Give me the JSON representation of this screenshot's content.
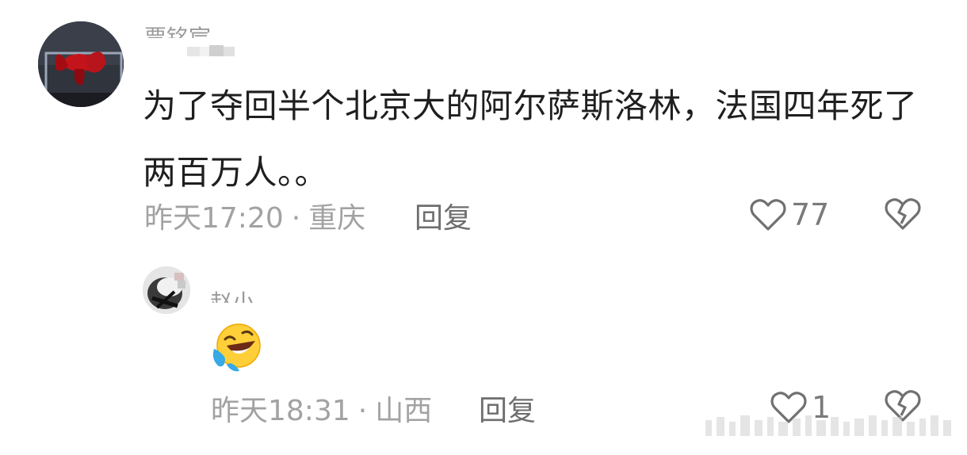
{
  "comment": {
    "username": "贾铭宸",
    "text": "为了夺回半个北京大的阿尔萨斯洛林，法国四年死了两百万人。。",
    "time": "昨天17:20",
    "location": "重庆",
    "reply_label": "回复",
    "like_count": "77",
    "icons": {
      "like": "heart-outline-icon",
      "dislike": "broken-heart-icon"
    }
  },
  "reply": {
    "username": "赵小",
    "emoji": "rolling-on-floor-laughing",
    "time": "昨天18:31",
    "location": "山西",
    "reply_label": "回复",
    "like_count": "1",
    "icons": {
      "like": "heart-outline-icon",
      "dislike": "broken-heart-icon"
    }
  },
  "meta_separator": "·",
  "colors": {
    "text": "#1f1f1f",
    "meta": "#a2a2a2",
    "reply_action": "#6e6e6e",
    "icon": "#707070"
  }
}
